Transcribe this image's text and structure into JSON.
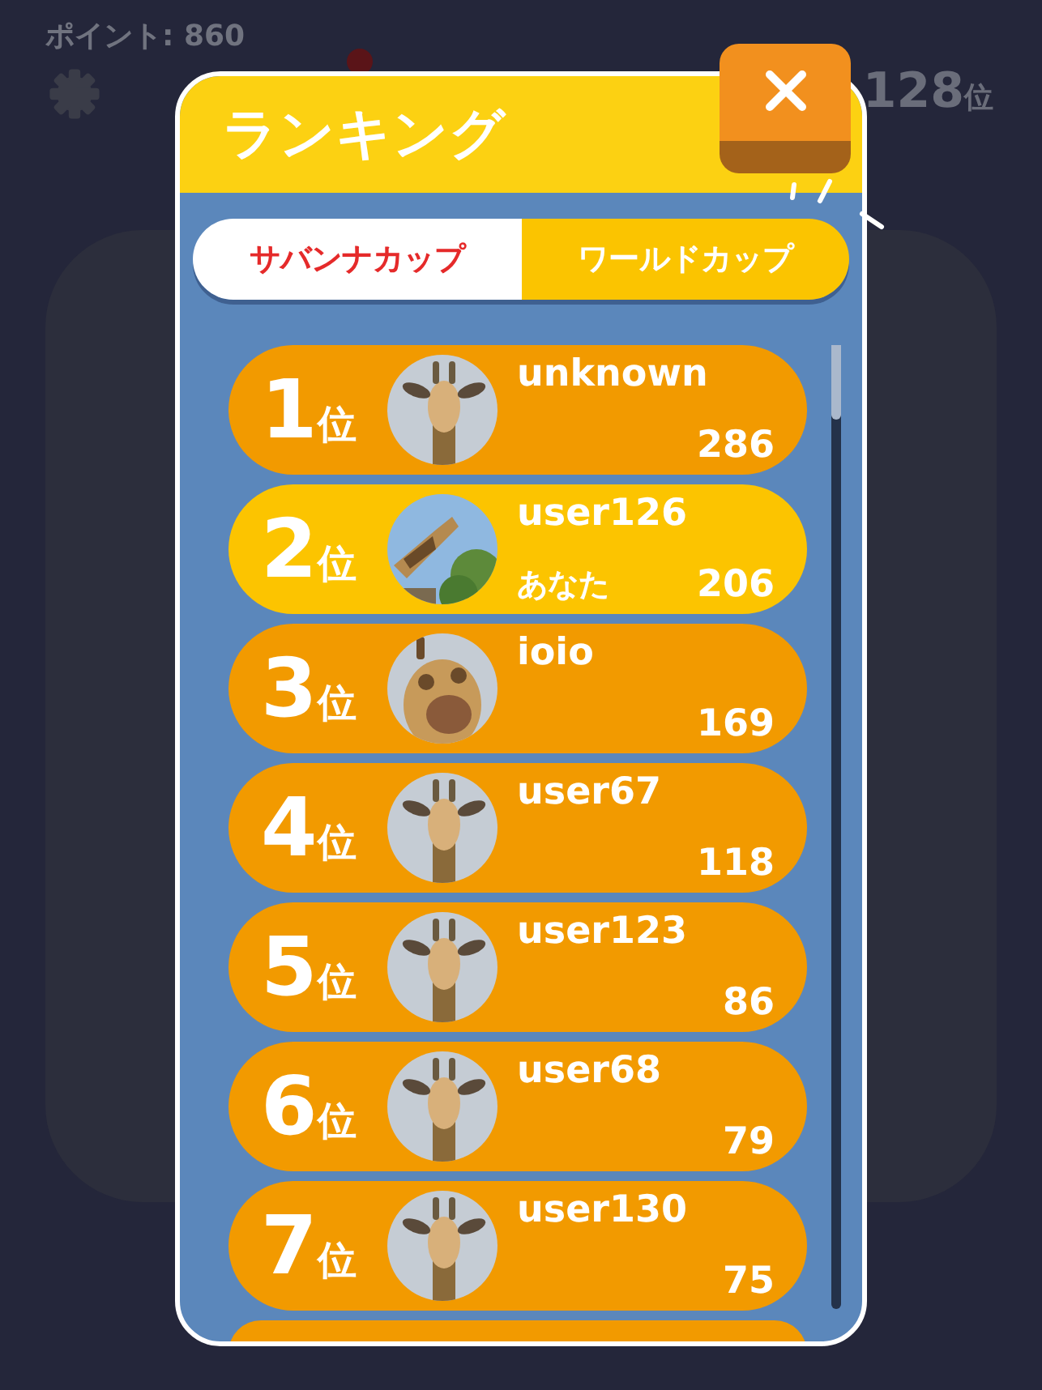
{
  "background": {
    "points": "ポイント: 860",
    "rank": "128",
    "rank_suffix": "位"
  },
  "dialog": {
    "title": "ランキング"
  },
  "tabs": [
    {
      "label": "サバンナカップ",
      "selected": true
    },
    {
      "label": "ワールドカップ",
      "selected": false
    }
  ],
  "ranking": [
    {
      "rank": "1",
      "suffix": "位",
      "name": "unknown",
      "score": "286",
      "highlighted": false
    },
    {
      "rank": "2",
      "suffix": "位",
      "name": "user126",
      "you_label": "あなた",
      "score": "206",
      "highlighted": true
    },
    {
      "rank": "3",
      "suffix": "位",
      "name": "ioio",
      "score": "169",
      "highlighted": false
    },
    {
      "rank": "4",
      "suffix": "位",
      "name": "user67",
      "score": "118",
      "highlighted": false
    },
    {
      "rank": "5",
      "suffix": "位",
      "name": "user123",
      "score": "86",
      "highlighted": false
    },
    {
      "rank": "6",
      "suffix": "位",
      "name": "user68",
      "score": "79",
      "highlighted": false
    },
    {
      "rank": "7",
      "suffix": "位",
      "name": "user130",
      "score": "75",
      "highlighted": false
    }
  ]
}
